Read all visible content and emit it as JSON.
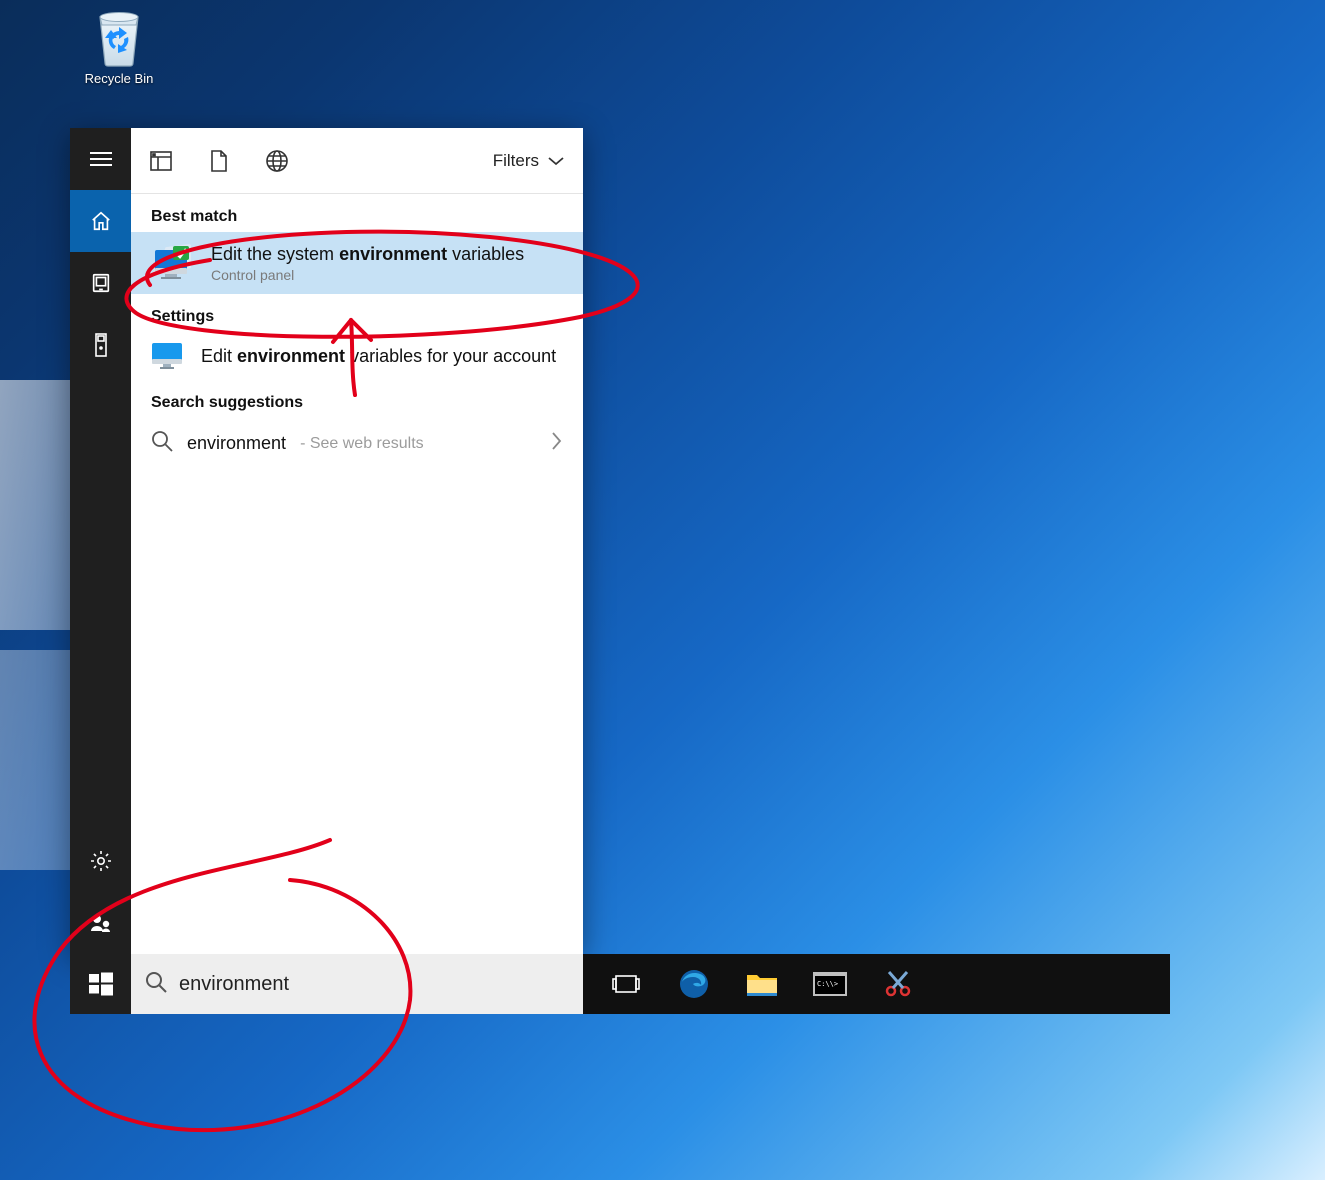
{
  "desktop": {
    "recycle_bin_label": "Recycle Bin"
  },
  "search_panel": {
    "filters_label": "Filters",
    "best_match_header": "Best match",
    "best_match": {
      "title_pre": "Edit the system ",
      "title_bold": "environment",
      "title_post": " variables",
      "subtitle": "Control panel"
    },
    "settings_header": "Settings",
    "settings_item": {
      "title_pre": "Edit ",
      "title_bold": "environment",
      "title_post": " variables for your account"
    },
    "suggestions_header": "Search suggestions",
    "suggestion": {
      "query": "environment",
      "tail": " - See web results"
    }
  },
  "search_input": {
    "value": "environment"
  },
  "taskbar": {
    "items": [
      "task-view",
      "edge",
      "file-explorer",
      "cmd",
      "snipping"
    ]
  }
}
